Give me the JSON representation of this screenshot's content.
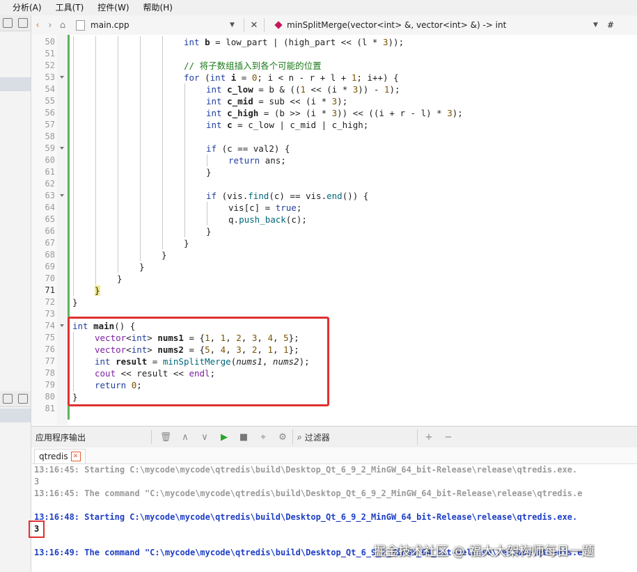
{
  "menubar": {
    "items": [
      "分析(A)",
      "工具(T)",
      "控件(W)",
      "帮助(H)"
    ]
  },
  "editor_toolbar": {
    "filename": "main.cpp",
    "function": "minSplitMerge(vector<int> &, vector<int> &) -> int",
    "hash": "#"
  },
  "code_lines": [
    {
      "num": "50",
      "indent": 5,
      "html": "<span class=\"kw\">int</span> <span class=\"b\">b</span> = low_part | (high_part &lt;&lt; (l * <span class=\"nm\">3</span>));"
    },
    {
      "num": "51",
      "indent": 5,
      "html": ""
    },
    {
      "num": "52",
      "indent": 5,
      "html": "<span class=\"cm\">// 将子数组插入到各个可能的位置</span>"
    },
    {
      "num": "53",
      "indent": 5,
      "fold": true,
      "html": "<span class=\"kw\">for</span> (<span class=\"kw\">int</span> <span class=\"b\">i</span> = <span class=\"nm\">0</span>; i &lt; n - r + l + <span class=\"nm\">1</span>; i++) {"
    },
    {
      "num": "54",
      "indent": 6,
      "html": "<span class=\"kw\">int</span> <span class=\"b\">c_low</span> = b &amp; ((<span class=\"nm\">1</span> &lt;&lt; (i * <span class=\"nm\">3</span>)) - <span class=\"nm\">1</span>);"
    },
    {
      "num": "55",
      "indent": 6,
      "html": "<span class=\"kw\">int</span> <span class=\"b\">c_mid</span> = sub &lt;&lt; (i * <span class=\"nm\">3</span>);"
    },
    {
      "num": "56",
      "indent": 6,
      "html": "<span class=\"kw\">int</span> <span class=\"b\">c_high</span> = (b &gt;&gt; (i * <span class=\"nm\">3</span>)) &lt;&lt; ((i + r - l) * <span class=\"nm\">3</span>);"
    },
    {
      "num": "57",
      "indent": 6,
      "html": "<span class=\"kw\">int</span> <span class=\"b\">c</span> = c_low | c_mid | c_high;"
    },
    {
      "num": "58",
      "indent": 6,
      "html": ""
    },
    {
      "num": "59",
      "indent": 6,
      "fold": true,
      "html": "<span class=\"kw\">if</span> (c == val2) {"
    },
    {
      "num": "60",
      "indent": 7,
      "html": "<span class=\"kw\">return</span> ans;"
    },
    {
      "num": "61",
      "indent": 6,
      "html": "}"
    },
    {
      "num": "62",
      "indent": 6,
      "html": ""
    },
    {
      "num": "63",
      "indent": 6,
      "fold": true,
      "html": "<span class=\"kw\">if</span> (vis.<span class=\"fn\">find</span>(c) == vis.<span class=\"fn\">end</span>()) {"
    },
    {
      "num": "64",
      "indent": 7,
      "html": "vis[c] = <span class=\"kw\">true</span>;"
    },
    {
      "num": "65",
      "indent": 7,
      "html": "q.<span class=\"fn\">push_back</span>(c);"
    },
    {
      "num": "66",
      "indent": 6,
      "html": "}"
    },
    {
      "num": "67",
      "indent": 5,
      "html": "}"
    },
    {
      "num": "68",
      "indent": 4,
      "html": "}"
    },
    {
      "num": "69",
      "indent": 3,
      "html": "}"
    },
    {
      "num": "70",
      "indent": 2,
      "html": "}"
    },
    {
      "num": "71",
      "indent": 1,
      "current": true,
      "html": "<span class=\"brace-hl\">}</span>"
    },
    {
      "num": "72",
      "indent": 0,
      "html": "}"
    },
    {
      "num": "73",
      "indent": 0,
      "html": ""
    },
    {
      "num": "74",
      "indent": 0,
      "fold": true,
      "html": "<span class=\"kw\">int</span> <span class=\"b\">main</span>() {"
    },
    {
      "num": "75",
      "indent": 1,
      "html": "<span class=\"ty\">vector</span>&lt;<span class=\"kw\">int</span>&gt; <span class=\"b\">nums1</span> = {<span class=\"nm\">1</span>, <span class=\"nm\">1</span>, <span class=\"nm\">2</span>, <span class=\"nm\">3</span>, <span class=\"nm\">4</span>, <span class=\"nm\">5</span>};"
    },
    {
      "num": "76",
      "indent": 1,
      "html": "<span class=\"ty\">vector</span>&lt;<span class=\"kw\">int</span>&gt; <span class=\"b\">nums2</span> = {<span class=\"nm\">5</span>, <span class=\"nm\">4</span>, <span class=\"nm\">3</span>, <span class=\"nm\">2</span>, <span class=\"nm\">1</span>, <span class=\"nm\">1</span>};"
    },
    {
      "num": "77",
      "indent": 1,
      "html": "<span class=\"kw\">int</span> <span class=\"b\">result</span> = <span class=\"fn\">minSplitMerge</span>(<span class=\"it\">nums1</span>, <span class=\"it\">nums2</span>);"
    },
    {
      "num": "78",
      "indent": 1,
      "html": "<span class=\"ty\">cout</span> &lt;&lt; result &lt;&lt; <span class=\"ty\">endl</span>;"
    },
    {
      "num": "79",
      "indent": 1,
      "html": "<span class=\"kw\">return</span> <span class=\"nm\">0</span>;"
    },
    {
      "num": "80",
      "indent": 0,
      "html": "}"
    },
    {
      "num": "81",
      "indent": 0,
      "html": ""
    }
  ],
  "output_panel": {
    "title": "应用程序输出",
    "filter_label": "过滤器",
    "tab_name": "qtredis",
    "lines": [
      {
        "style": "gray",
        "text": "13:16:45: Starting C:\\mycode\\mycode\\qtredis\\build\\Desktop_Qt_6_9_2_MinGW_64_bit-Release\\release\\qtredis.exe."
      },
      {
        "style": "plain",
        "text": "3"
      },
      {
        "style": "gray",
        "text": "13:16:45: The command \"C:\\mycode\\mycode\\qtredis\\build\\Desktop_Qt_6_9_2_MinGW_64_bit-Release\\release\\qtredis.e"
      },
      {
        "style": "blank",
        "text": ""
      },
      {
        "style": "blue",
        "text": "13:16:48: Starting C:\\mycode\\mycode\\qtredis\\build\\Desktop_Qt_6_9_2_MinGW_64_bit-Release\\release\\qtredis.exe."
      },
      {
        "style": "dark",
        "text": "3"
      },
      {
        "style": "blank",
        "text": ""
      },
      {
        "style": "blue",
        "text": "13:16:49: The command \"C:\\mycode\\mycode\\qtredis\\build\\Desktop_Qt_6_9_2_MinGW_64_bit-Release\\release\\qtredis.e"
      }
    ]
  },
  "watermark": "掘金技术社区 @ 福大大架构师每日一题",
  "colors": {
    "highlight_border": "#e0302f",
    "run_green": "#2aa52a",
    "keyword_blue": "#1f3fa0"
  }
}
